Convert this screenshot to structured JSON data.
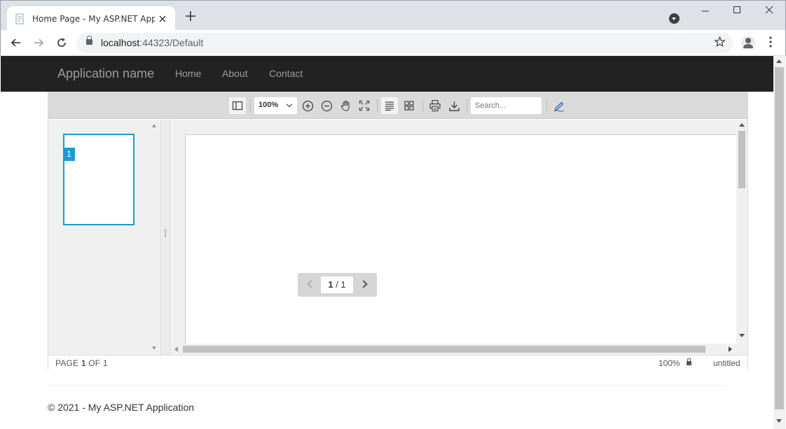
{
  "browser": {
    "tab_title": "Home Page - My ASP.NET Applic",
    "new_tab_label": "+",
    "url_host": "localhost",
    "url_rest": ":44323/Default"
  },
  "site": {
    "brand": "Application name",
    "nav": [
      "Home",
      "About",
      "Contact"
    ],
    "footer": "© 2021 - My ASP.NET Application"
  },
  "pdf_viewer": {
    "zoom": "100%",
    "search_placeholder": "Search...",
    "thumbnail_number": "1",
    "pager_current": "1",
    "pager_total": "1",
    "status_page_prefix": "PAGE",
    "status_page_current": "1",
    "status_page_of": "OF 1",
    "status_zoom": "100%",
    "status_filename": "untitled"
  },
  "colors": {
    "navbar_bg": "#222222",
    "accent": "#1a9bd7"
  }
}
